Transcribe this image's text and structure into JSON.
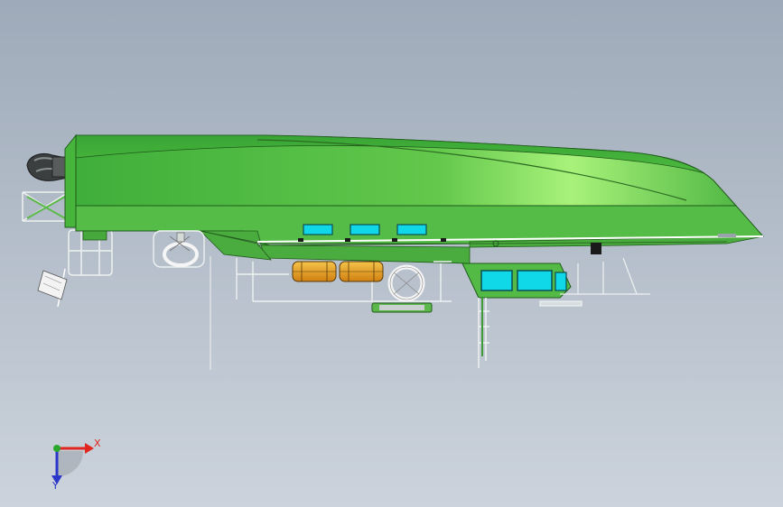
{
  "triad": {
    "x_label": "X",
    "y_label": "Y",
    "x_color": "#e0261f",
    "y_color": "#2a37c9",
    "z_color": "#2aa82e"
  },
  "colors": {
    "background_top": "#9eaab9",
    "background_bottom": "#ccd3dc",
    "hull_green": "#5cc04b",
    "hull_light": "#a8f27a",
    "window_cyan": "#10d8e8",
    "liferaft_orange": "#e8a020"
  }
}
